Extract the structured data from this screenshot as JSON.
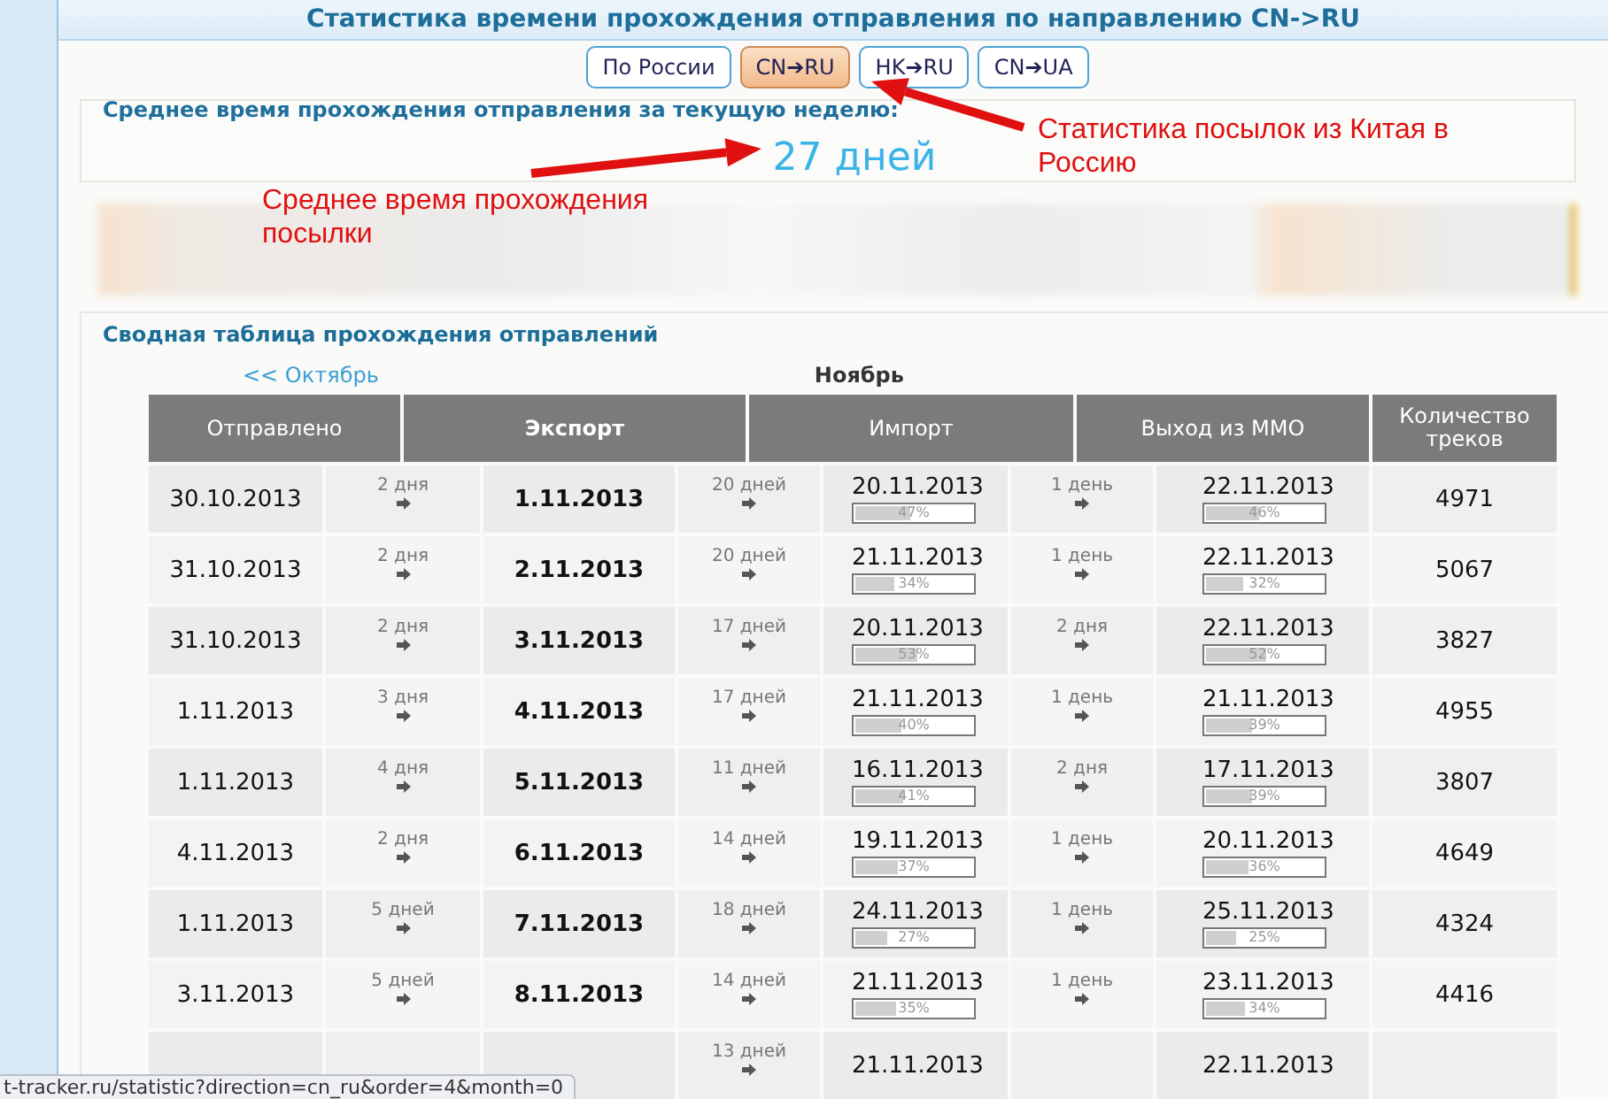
{
  "title": "Статистика времени прохождения отправления по направлению CN->RU",
  "tabs": [
    {
      "label": "По России",
      "selected": false
    },
    {
      "label": "CN➔RU",
      "selected": true
    },
    {
      "label": "HK➔RU",
      "selected": false
    },
    {
      "label": "CN➔UA",
      "selected": false
    }
  ],
  "average": {
    "heading": "Среднее время прохождения отправления за текущую неделю:",
    "value": "27 дней"
  },
  "annotations": [
    {
      "text": "Среднее время прохождения посылки"
    },
    {
      "text": "Статистика посылок из Китая в Россию"
    }
  ],
  "summary": {
    "heading": "Сводная таблица прохождения отправлений",
    "prev_month": "<< Октябрь",
    "month": "Ноябрь",
    "columns": [
      "Отправлено",
      "Экспорт",
      "Импорт",
      "Выход из ММО",
      "Количество треков"
    ],
    "rows": [
      {
        "sent": "30.10.2013",
        "to_export": "2 дня",
        "export": "1.11.2013",
        "to_import": "20 дней",
        "import": {
          "date": "20.11.2013",
          "level": 0.47,
          "reading": "47%"
        },
        "to_exit": "1 день",
        "exit": {
          "date": "22.11.2013",
          "level": 0.46,
          "reading": "46%"
        },
        "count": "4971"
      },
      {
        "sent": "31.10.2013",
        "to_export": "2 дня",
        "export": "2.11.2013",
        "to_import": "20 дней",
        "import": {
          "date": "21.11.2013",
          "level": 0.34,
          "reading": "34%"
        },
        "to_exit": "1 день",
        "exit": {
          "date": "22.11.2013",
          "level": 0.32,
          "reading": "32%"
        },
        "count": "5067"
      },
      {
        "sent": "31.10.2013",
        "to_export": "2 дня",
        "export": "3.11.2013",
        "to_import": "17 дней",
        "import": {
          "date": "20.11.2013",
          "level": 0.53,
          "reading": "53%"
        },
        "to_exit": "2 дня",
        "exit": {
          "date": "22.11.2013",
          "level": 0.52,
          "reading": "52%"
        },
        "count": "3827"
      },
      {
        "sent": "1.11.2013",
        "to_export": "3 дня",
        "export": "4.11.2013",
        "to_import": "17 дней",
        "import": {
          "date": "21.11.2013",
          "level": 0.4,
          "reading": "40%"
        },
        "to_exit": "1 день",
        "exit": {
          "date": "21.11.2013",
          "level": 0.39,
          "reading": "39%"
        },
        "count": "4955"
      },
      {
        "sent": "1.11.2013",
        "to_export": "4 дня",
        "export": "5.11.2013",
        "to_import": "11 дней",
        "import": {
          "date": "16.11.2013",
          "level": 0.41,
          "reading": "41%"
        },
        "to_exit": "2 дня",
        "exit": {
          "date": "17.11.2013",
          "level": 0.39,
          "reading": "39%"
        },
        "count": "3807"
      },
      {
        "sent": "4.11.2013",
        "to_export": "2 дня",
        "export": "6.11.2013",
        "to_import": "14 дней",
        "import": {
          "date": "19.11.2013",
          "level": 0.37,
          "reading": "37%"
        },
        "to_exit": "1 день",
        "exit": {
          "date": "20.11.2013",
          "level": 0.36,
          "reading": "36%"
        },
        "count": "4649"
      },
      {
        "sent": "1.11.2013",
        "to_export": "5 дней",
        "export": "7.11.2013",
        "to_import": "18 дней",
        "import": {
          "date": "24.11.2013",
          "level": 0.27,
          "reading": "27%"
        },
        "to_exit": "1 день",
        "exit": {
          "date": "25.11.2013",
          "level": 0.25,
          "reading": "25%"
        },
        "count": "4324"
      },
      {
        "sent": "3.11.2013",
        "to_export": "5 дней",
        "export": "8.11.2013",
        "to_import": "14 дней",
        "import": {
          "date": "21.11.2013",
          "level": 0.35,
          "reading": "35%"
        },
        "to_exit": "1 день",
        "exit": {
          "date": "23.11.2013",
          "level": 0.34,
          "reading": "34%"
        },
        "count": "4416"
      },
      {
        "to_import": "13 дней",
        "import": {
          "date": "21.11.2013"
        },
        "exit": {
          "date": "22.11.2013"
        }
      }
    ]
  },
  "status_bar": {
    "url": "t-tracker.ru/statistic?direction=cn_ru&order=4&month=0"
  }
}
